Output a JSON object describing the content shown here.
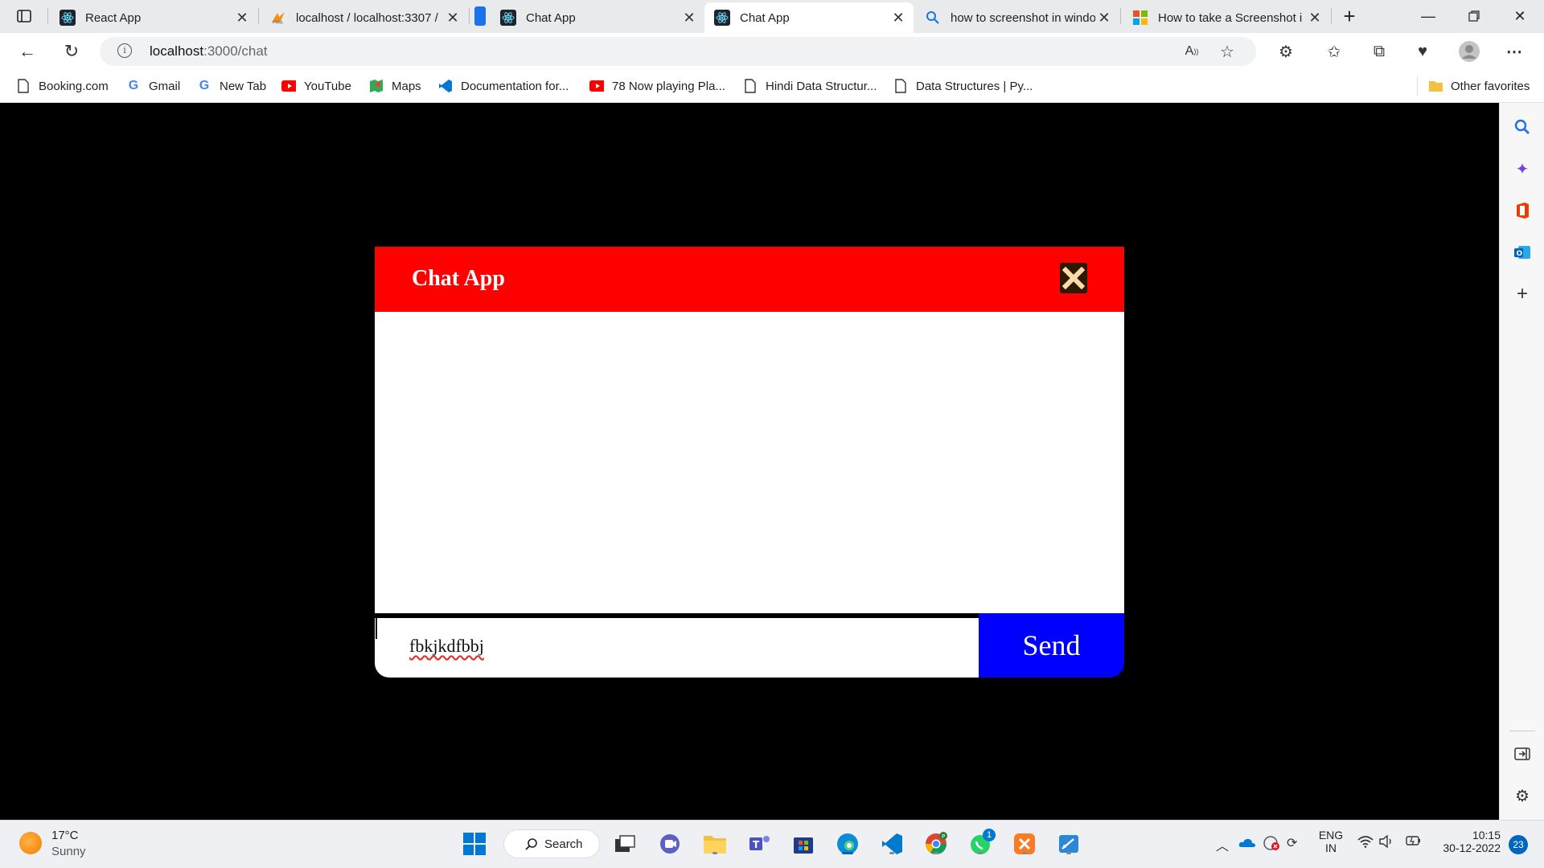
{
  "browser": {
    "tabs": [
      {
        "title": "React App",
        "icon": "react-icon"
      },
      {
        "title": "localhost / localhost:3307 /",
        "icon": "phpmyadmin-icon"
      },
      {
        "title": "Chat App",
        "icon": "react-icon"
      },
      {
        "title": "Chat App",
        "icon": "react-icon",
        "active": true
      },
      {
        "title": "how to screenshot in windo",
        "icon": "search-icon"
      },
      {
        "title": "How to take a Screenshot i",
        "icon": "microsoft-icon"
      }
    ],
    "address": {
      "host": "localhost",
      "path": ":3000/chat"
    },
    "bookmarks": [
      {
        "label": "Booking.com",
        "icon": "page-icon"
      },
      {
        "label": "Gmail",
        "icon": "google-icon"
      },
      {
        "label": "New Tab",
        "icon": "google-icon"
      },
      {
        "label": "YouTube",
        "icon": "youtube-icon"
      },
      {
        "label": "Maps",
        "icon": "maps-icon"
      },
      {
        "label": "Documentation for...",
        "icon": "vscode-icon"
      },
      {
        "label": "78 Now playing Pla...",
        "icon": "youtube-icon"
      },
      {
        "label": "Hindi Data Structur...",
        "icon": "page-icon"
      },
      {
        "label": "Data Structures | Py...",
        "icon": "page-icon"
      }
    ],
    "other_favorites": "Other favorites"
  },
  "chat": {
    "title": "Chat App",
    "input_value": "fbkjkdfbbj",
    "send_label": "Send",
    "colors": {
      "header": "#ff0000",
      "send": "#0000ff",
      "page_bg": "#000000"
    }
  },
  "taskbar": {
    "weather": {
      "temp": "17°C",
      "condition": "Sunny"
    },
    "search_label": "Search",
    "language": {
      "lang": "ENG",
      "region": "IN"
    },
    "clock": {
      "time": "10:15",
      "date": "30-12-2022"
    },
    "notification_count": "23",
    "whatsapp_badge": "1"
  }
}
